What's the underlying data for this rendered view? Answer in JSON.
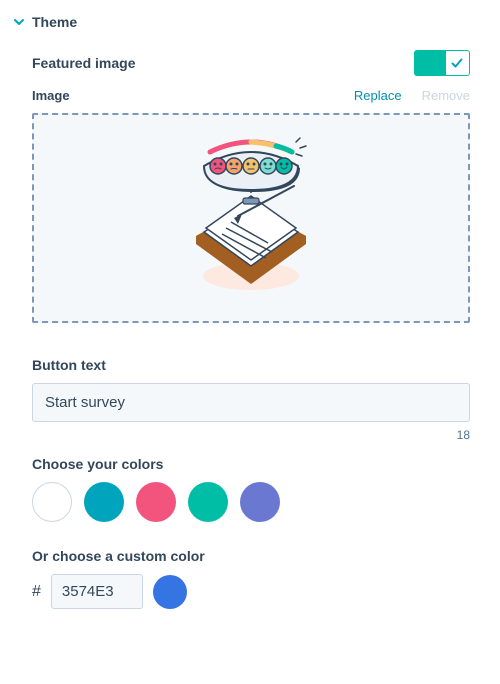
{
  "section": {
    "title": "Theme"
  },
  "featured_image": {
    "label": "Featured image",
    "image_label": "Image",
    "actions": {
      "replace": "Replace",
      "remove": "Remove"
    },
    "toggle_on": true
  },
  "button_text": {
    "label": "Button text",
    "value": "Start survey",
    "char_count": "18"
  },
  "colors": {
    "label": "Choose your colors",
    "swatches": [
      {
        "name": "white",
        "hex": "#ffffff"
      },
      {
        "name": "teal",
        "hex": "#00a4bd"
      },
      {
        "name": "pink",
        "hex": "#f2547d"
      },
      {
        "name": "green",
        "hex": "#00bda5"
      },
      {
        "name": "purple",
        "hex": "#6a78d1"
      }
    ]
  },
  "custom_color": {
    "label": "Or choose a custom color",
    "hash": "#",
    "hex": "3574E3"
  }
}
